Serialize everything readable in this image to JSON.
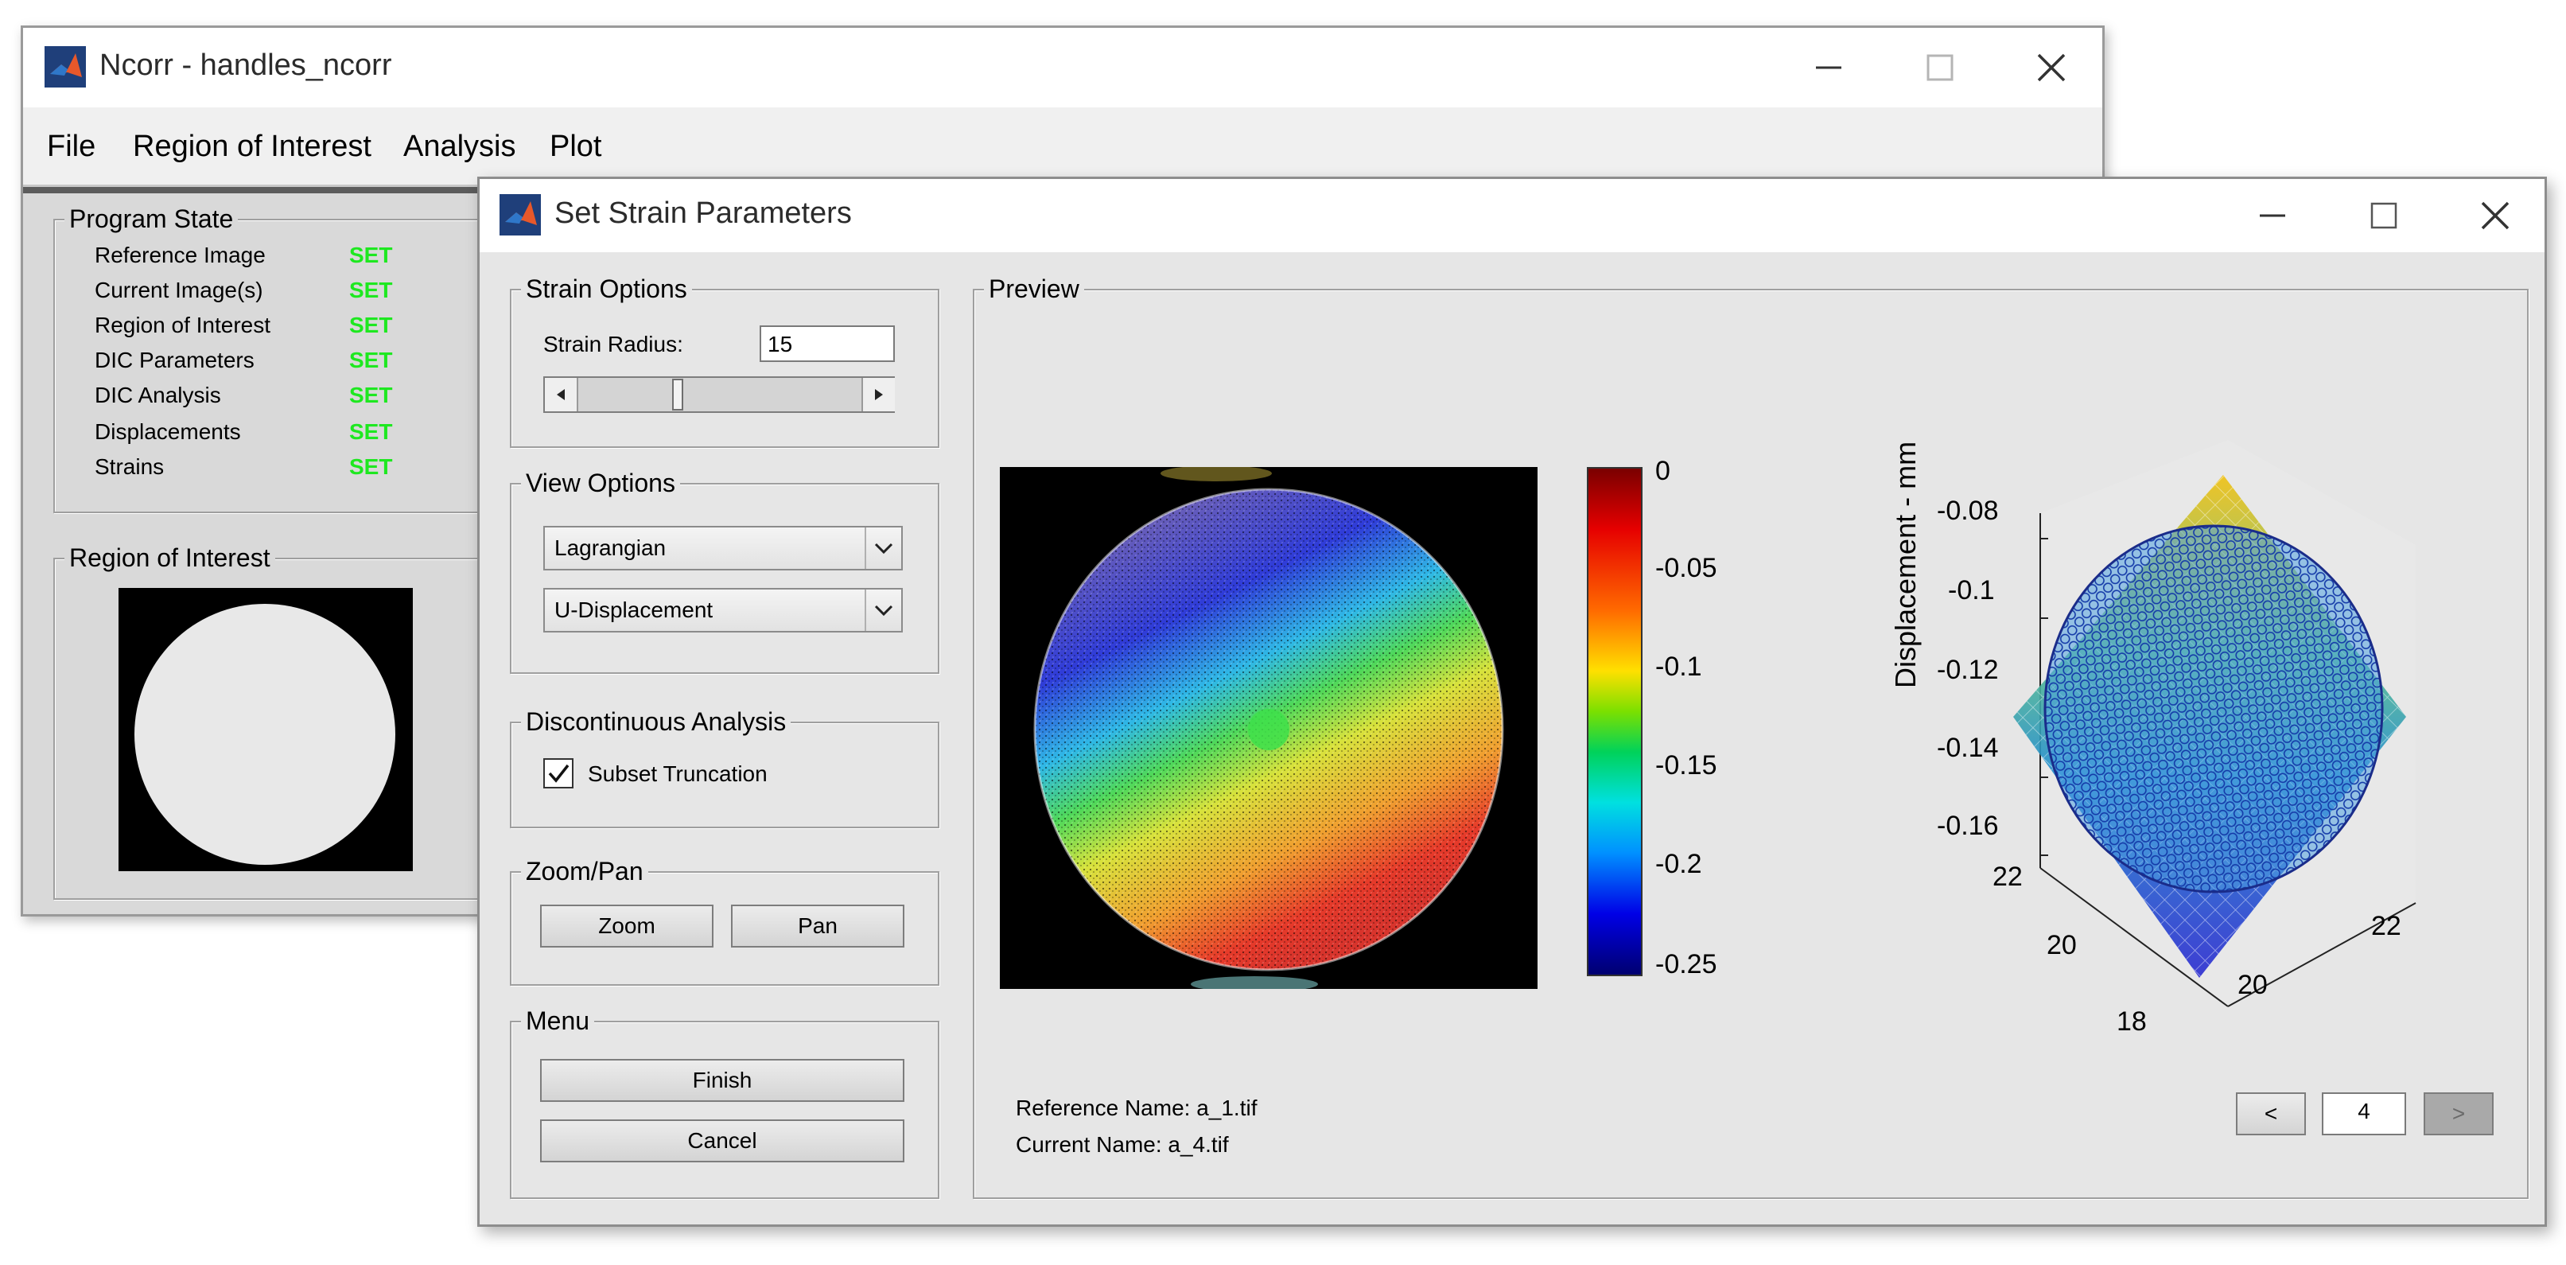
{
  "main_window": {
    "title": "Ncorr - handles_ncorr",
    "menu": [
      "File",
      "Region of Interest",
      "Analysis",
      "Plot"
    ],
    "program_state": {
      "title": "Program State",
      "rows": [
        {
          "label": "Reference Image",
          "value": "SET"
        },
        {
          "label": "Current Image(s)",
          "value": "SET"
        },
        {
          "label": "Region of Interest",
          "value": "SET"
        },
        {
          "label": "DIC Parameters",
          "value": "SET"
        },
        {
          "label": "DIC Analysis",
          "value": "SET"
        },
        {
          "label": "Displacements",
          "value": "SET"
        },
        {
          "label": "Strains",
          "value": "SET"
        }
      ]
    },
    "roi_panel": {
      "title": "Region of Interest"
    }
  },
  "dialog": {
    "title": "Set Strain Parameters",
    "strain_options": {
      "title": "Strain Options",
      "radius_label": "Strain Radius:",
      "radius_value": "15",
      "slider_level": 0.4
    },
    "view_options": {
      "title": "View Options",
      "reference_selected": "Lagrangian",
      "field_selected": "U-Displacement"
    },
    "discontinuous": {
      "title": "Discontinuous Analysis",
      "checkbox_label": "Subset Truncation",
      "checked": true
    },
    "zoom_pan": {
      "title": "Zoom/Pan",
      "zoom_label": "Zoom",
      "pan_label": "Pan"
    },
    "menu": {
      "title": "Menu",
      "finish_label": "Finish",
      "cancel_label": "Cancel"
    },
    "preview": {
      "title": "Preview",
      "reference_name": "Reference Name: a_1.tif",
      "current_name": "Current Name: a_4.tif",
      "prev_label": "<",
      "next_label": ">",
      "image_index": "4"
    }
  },
  "colorbar": {
    "ticks": [
      "0",
      "-0.05",
      "-0.1",
      "-0.15",
      "-0.2",
      "-0.25"
    ]
  },
  "surface_plot": {
    "z_label": "Displacement - mm",
    "z_ticks": [
      "-0.08",
      "-0.1",
      "-0.12",
      "-0.14",
      "-0.16"
    ],
    "x_ticks": [
      "22",
      "20",
      "18"
    ],
    "y_ticks": [
      "20",
      "22"
    ]
  },
  "colors": {
    "set_green": "#1ee820",
    "dialog_bg": "#e6e6e6",
    "main_bg": "#d9d9d9"
  }
}
